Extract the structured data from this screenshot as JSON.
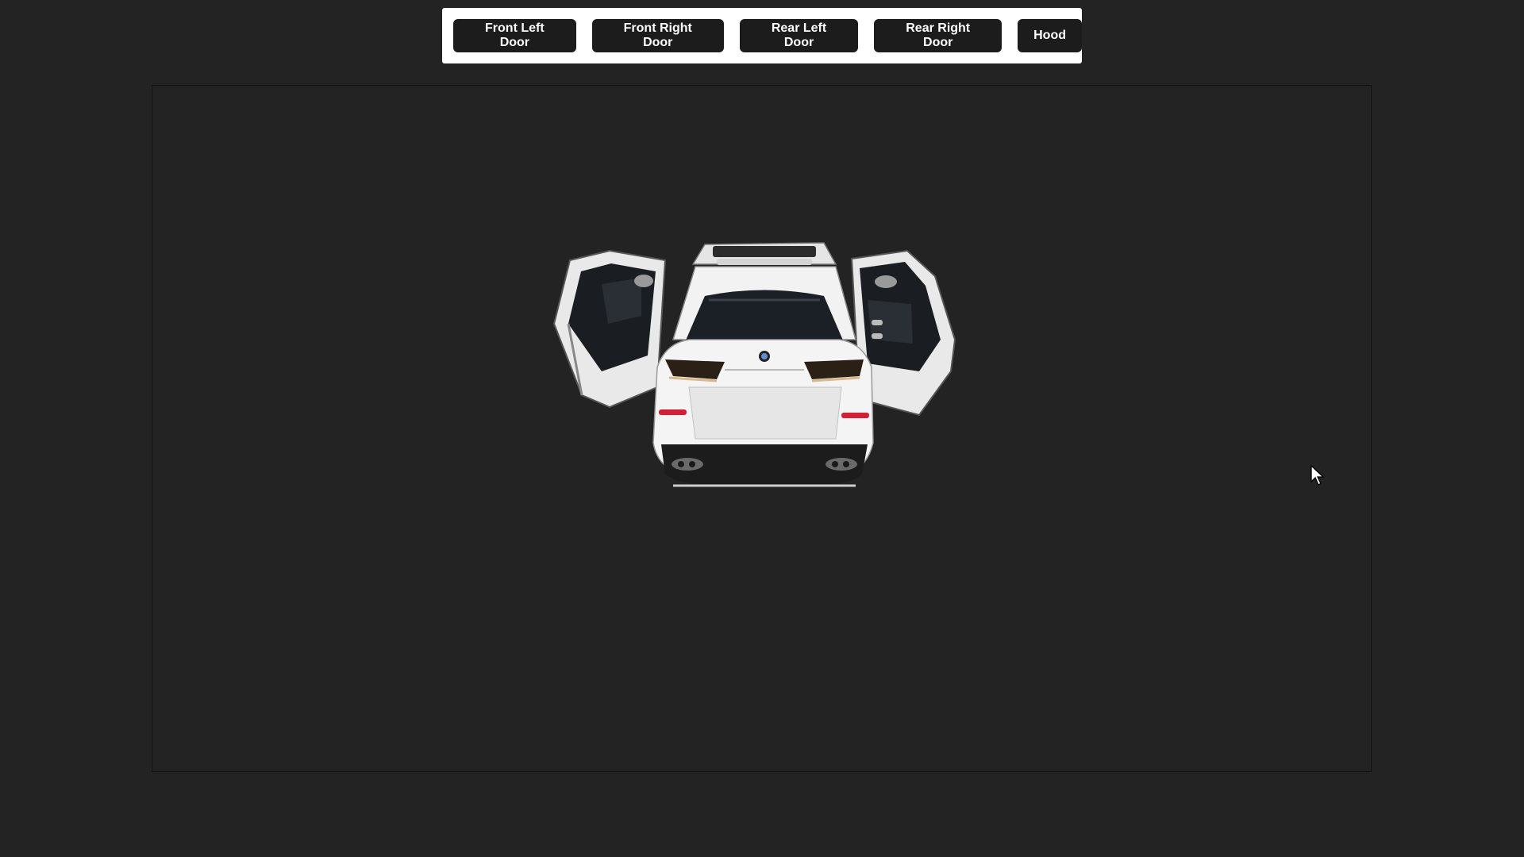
{
  "toolbar": {
    "buttons": [
      {
        "label": "Front Left Door"
      },
      {
        "label": "Front Right Door"
      },
      {
        "label": "Rear Left Door"
      },
      {
        "label": "Rear Right Door"
      },
      {
        "label": "Hood"
      }
    ]
  },
  "viewer": {
    "model": "white SUV rear view with four doors open"
  },
  "colors": {
    "background": "#232323",
    "toolbar_bg": "#ffffff",
    "button_bg": "#1c1c1c",
    "button_text": "#ffffff",
    "car_body": "#f2f2f2"
  }
}
